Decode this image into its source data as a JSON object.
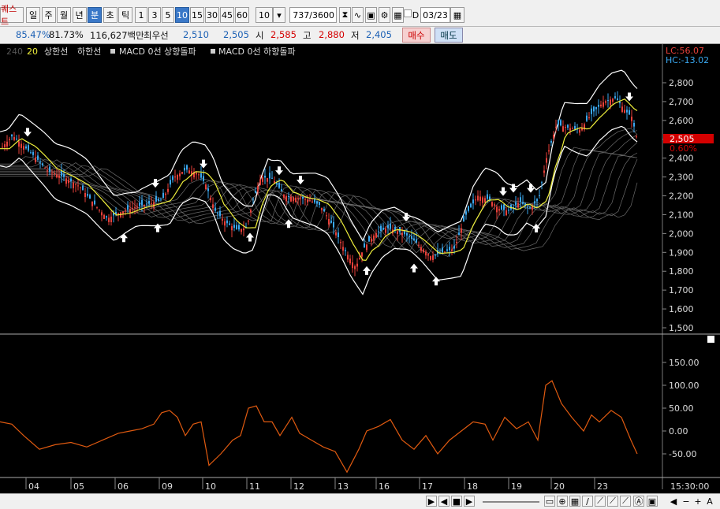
{
  "toolbar": {
    "tab_label": "퀘스트",
    "period_buttons": [
      "일",
      "주",
      "월",
      "년",
      "분",
      "초",
      "틱"
    ],
    "active_period": "분",
    "interval_buttons": [
      "1",
      "3",
      "5",
      "10",
      "15",
      "30",
      "45",
      "60"
    ],
    "active_interval": "10",
    "interval_select": "10",
    "count_value": "737",
    "count_total": "/3600",
    "date_checkbox_label": "D",
    "date_value": "03/23"
  },
  "infobar": {
    "pct1": "85.47%",
    "pct2": "81.73%",
    "volume": "116,627백만",
    "label_best": "최우선",
    "best_ask": "2,510",
    "best_bid": "2,505",
    "open_label": "시",
    "open": "2,585",
    "high_label": "고",
    "high": "2,880",
    "low_label": "저",
    "low": "2,405",
    "buy_label": "매수",
    "sell_label": "매도"
  },
  "legend": {
    "partial_left": "240",
    "period20": "20",
    "upper_band": "상한선",
    "lower_band": "하한선",
    "macd_up": "MACD 0선 상향돌파",
    "macd_down": "MACD 0선 하향돌파"
  },
  "price_panel": {
    "lc": "LC:56.07",
    "hc": "HC:-13.02",
    "current_price": "2,505",
    "current_change": "0.60%",
    "y_ticks": [
      "2,800",
      "2,700",
      "2,600",
      "2,500",
      "2,400",
      "2,300",
      "2,200",
      "2,100",
      "2,000",
      "1,900",
      "1,800",
      "1,700",
      "1,600",
      "1,500"
    ]
  },
  "osc_panel": {
    "y_ticks": [
      "150.00",
      "100.00",
      "50.00",
      "0.00",
      "-50.00"
    ]
  },
  "x_axis": {
    "labels": [
      "04",
      "05",
      "06",
      "09",
      "10",
      "11",
      "12",
      "13",
      "16",
      "17",
      "18",
      "19",
      "20",
      "23"
    ],
    "time_label": "15:30:00"
  },
  "colors": {
    "candle_up": "#e8413a",
    "candle_down": "#3aa8f0",
    "band": "#ffffff",
    "ma20": "#f0f03c",
    "osc_line": "#e05a10",
    "price_marker": "#d40000"
  },
  "chart_data": {
    "type": "line",
    "title": "",
    "price_series": {
      "name": "20",
      "x_days": [
        "04",
        "05",
        "06",
        "09",
        "10",
        "11",
        "12",
        "13",
        "16",
        "17",
        "18",
        "19",
        "20",
        "23"
      ],
      "close_approx": [
        2480,
        2280,
        2120,
        2280,
        2050,
        2220,
        2200,
        1920,
        2000,
        1900,
        2150,
        2130,
        2600,
        2505
      ]
    },
    "oscillator_series": {
      "name": "MACD",
      "values_approx": [
        10,
        -40,
        -20,
        15,
        -10,
        40,
        25,
        -40,
        10,
        -25,
        0,
        15,
        105,
        30,
        -50
      ]
    },
    "y_price_range": [
      1500,
      2850
    ],
    "y_osc_range": [
      -70,
      180
    ]
  }
}
